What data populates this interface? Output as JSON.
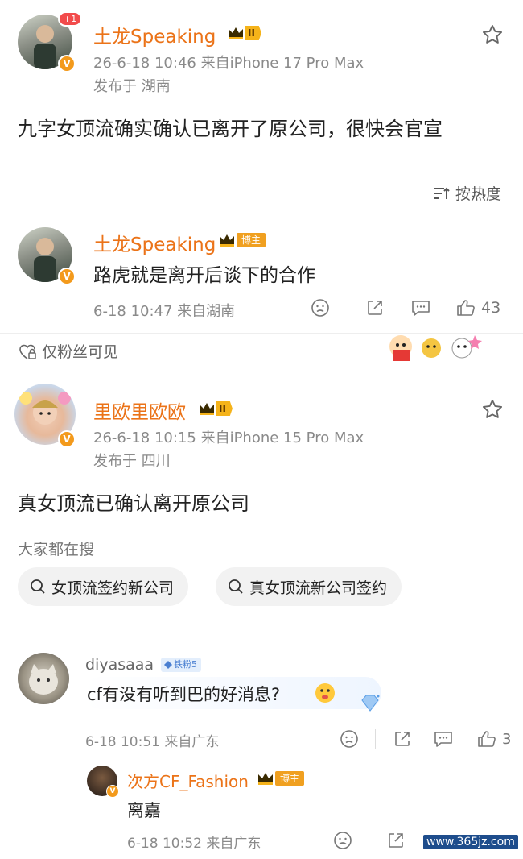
{
  "post1": {
    "username": "土龙Speaking",
    "level": "II",
    "plus_badge": "+1",
    "time_device": "26-6-18 10:46  来自iPhone 17 Pro Max",
    "location": "发布于 湖南",
    "text": "九字女顶流确实确认已离开了原公司，很快会官宣"
  },
  "sort": {
    "label": "按热度"
  },
  "comment1": {
    "username": "土龙Speaking",
    "boz_badge": "博主",
    "text": "路虎就是离开后谈下的合作",
    "time_location": "6-18 10:47  来自湖南",
    "likes": "43"
  },
  "fans_only": {
    "label": "仅粉丝可见"
  },
  "post2": {
    "username": "里欧里欧欧",
    "level": "II",
    "time_device": "26-6-18 10:15  来自iPhone 15 Pro Max",
    "location": "发布于 四川",
    "text": "真女顶流已确认离开原公司"
  },
  "search": {
    "heading": "大家都在搜",
    "chips": [
      "女顶流签约新公司",
      "真女顶流新公司签约"
    ]
  },
  "comment2": {
    "username": "diyasaaa",
    "fan_badge": "铁粉5",
    "text": "cf有没有听到巴的好消息?",
    "time_location": "6-18 10:51  来自广东",
    "likes": "3"
  },
  "reply": {
    "username": "次方CF_Fashion",
    "boz_badge": "博主",
    "text": "离嘉",
    "time_location": "6-18 10:52  来自广东"
  },
  "watermark": "www.365jz.com",
  "colors": {
    "username": "#eb7318",
    "meta": "#8a8a8a",
    "badge": "#f5b31a"
  }
}
